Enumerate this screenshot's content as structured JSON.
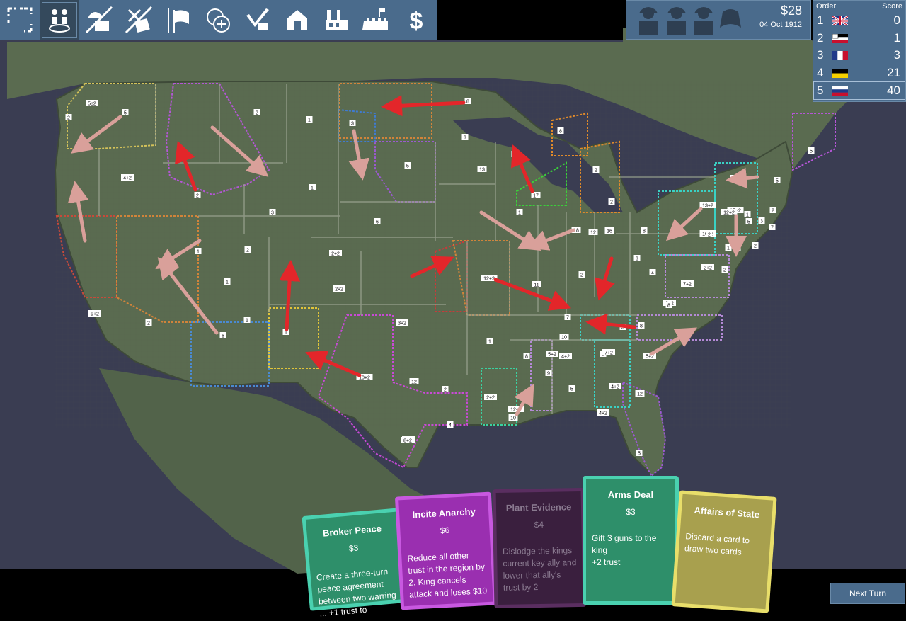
{
  "toolbar": {
    "tools": [
      {
        "name": "select",
        "icon": "select-icon"
      },
      {
        "name": "diplomats",
        "icon": "diplomats-icon"
      },
      {
        "name": "hire-agent",
        "icon": "agent-icon"
      },
      {
        "name": "war-treaty",
        "icon": "war-treaty-icon"
      },
      {
        "name": "flags",
        "icon": "flags-icon"
      },
      {
        "name": "add-coins",
        "icon": "coins-add-icon"
      },
      {
        "name": "build",
        "icon": "build-icon"
      },
      {
        "name": "barn",
        "icon": "barn-icon"
      },
      {
        "name": "factory",
        "icon": "factory-icon"
      },
      {
        "name": "fort",
        "icon": "fort-icon"
      },
      {
        "name": "finance",
        "icon": "dollar-icon"
      }
    ]
  },
  "status": {
    "money": "$28",
    "date": "04 Oct 1912",
    "players": [
      "player-1-icon",
      "player-2-icon",
      "player-3-icon",
      "player-4-icon"
    ]
  },
  "scoreboard": {
    "order_header": "Order",
    "score_header": "Score",
    "rows": [
      {
        "rank": "1",
        "flag": "uk-flag",
        "score": "0"
      },
      {
        "rank": "2",
        "flag": "kaiser-flag",
        "score": "1"
      },
      {
        "rank": "3",
        "flag": "france-flag",
        "score": "3"
      },
      {
        "rank": "4",
        "flag": "black-yellow-flag",
        "score": "21"
      },
      {
        "rank": "5",
        "flag": "russia-flag",
        "score": "40"
      }
    ]
  },
  "map_labels": [
    "5±2",
    "5",
    "1",
    "2",
    "2",
    "8",
    "4+2",
    "3",
    "2",
    "3",
    "1",
    "6",
    "5",
    "3",
    "8",
    "5",
    "2",
    "13",
    "17",
    "8",
    "2",
    "2+2",
    "1",
    "2",
    "18",
    "12",
    "5±2",
    "5",
    "12+2",
    "16",
    "1",
    "2",
    "16+2",
    "15+2",
    "8",
    "3",
    "2",
    "4",
    "5",
    "3",
    "4",
    "7+2",
    "2+2",
    "1",
    "6",
    "1",
    "2",
    "1",
    "1",
    "3+2",
    "1",
    "10",
    "12+2",
    "11",
    "8",
    "2+2",
    "4+2",
    "5+2",
    "2+2",
    "8",
    "3",
    "7",
    "5",
    "9+2",
    "10+2",
    "7+2",
    "4+2",
    "12",
    "2",
    "4",
    "10",
    "5",
    "12",
    "7+2",
    "4+2",
    "5",
    "9",
    "8",
    "2",
    "2+2",
    "1",
    "7",
    "5+2",
    "2",
    "13+2",
    "2",
    "2",
    "1",
    "12+2",
    "8+2"
  ],
  "cards": [
    {
      "title": "Broker Peace",
      "cost": "$3",
      "desc": "Create a three-turn peace agreement between two warring ... +1 trust to"
    },
    {
      "title": "Incite Anarchy",
      "cost": "$6",
      "desc": "Reduce all other trust in the region by 2. King cancels attack and loses $10"
    },
    {
      "title": "Plant Evidence",
      "cost": "$4",
      "desc": "Dislodge the kings current key ally and lower that ally's trust by 2"
    },
    {
      "title": "Arms Deal",
      "cost": "$3",
      "desc": "Gift 3 guns to the king\n +2 trust"
    },
    {
      "title": "Affairs of State",
      "cost": "",
      "desc": "Discard a card to draw two cards"
    }
  ],
  "next_turn_label": "Next Turn",
  "colors": {
    "toolbar": "#4a6b8c",
    "land": "#5a6b50",
    "ocean": "#3a3d52",
    "arrow_red": "#e3262a",
    "arrow_pink": "#d9a09a"
  }
}
